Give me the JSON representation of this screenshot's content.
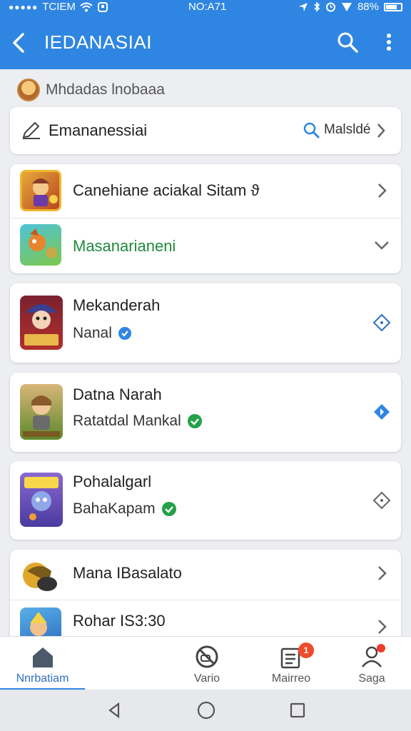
{
  "status": {
    "carrier": "TCIEM",
    "time": "NO:A71",
    "battery": "88%"
  },
  "appbar": {
    "title": "IEDANASIAI"
  },
  "section": {
    "label": "Mhdadas lnobaaa"
  },
  "search_row": {
    "label": "Emananessiai",
    "action": "Malsldé"
  },
  "group1": [
    {
      "title": "Canehiane aciakal Sitam ϑ",
      "trail": "chevron-right-icon"
    },
    {
      "title": "Masanarianeni",
      "trail": "chevron-down-icon"
    }
  ],
  "cards": [
    {
      "title": "Mekanderah",
      "subtitle": "Nanal",
      "badge": "blue-check",
      "trail": "diamond-outline-icon"
    },
    {
      "title": "Datna Narah",
      "subtitle": "Ratatdal Mankal",
      "badge": "green-check",
      "trail": "diamond-filled-icon"
    },
    {
      "title": "Pohalalgarl",
      "subtitle": "BahaKapam",
      "badge": "green-check",
      "trail": "diamond-outline-icon"
    }
  ],
  "group2": [
    {
      "title": "Mana IBasalato",
      "trail": "chevron-right-icon"
    },
    {
      "title": "Rohar IS3:30",
      "trail": "chevron-right-icon"
    }
  ],
  "bottomnav": [
    {
      "label": "Nnrbatiam",
      "icon": "home-icon"
    },
    {
      "label": "Vario",
      "icon": "no-camera-icon"
    },
    {
      "label": "Mairreo",
      "icon": "list-icon",
      "badge": "1"
    },
    {
      "label": "Saga",
      "icon": "profile-icon"
    }
  ],
  "colors": {
    "primary": "#2f86e2",
    "green": "#1e8a3a",
    "badge": "#ef4a2b"
  }
}
